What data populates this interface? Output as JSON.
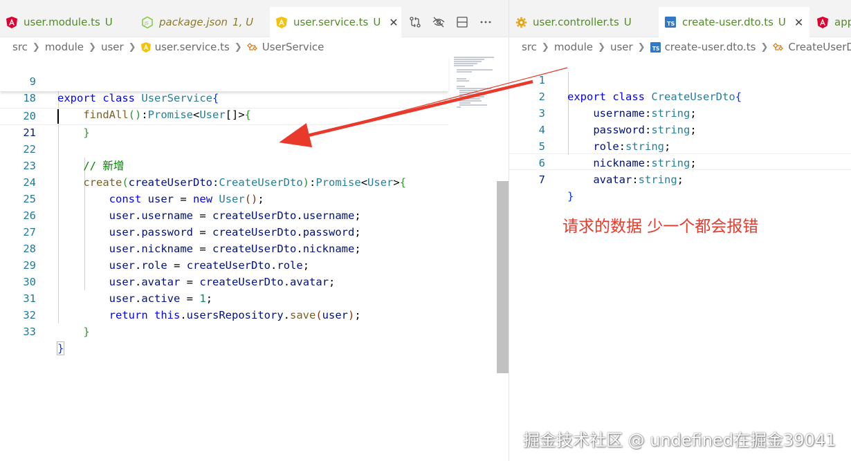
{
  "left_tabs": [
    {
      "label": "user.module.ts",
      "status": "U",
      "icon": "angular-icon",
      "active": false,
      "italic": false
    },
    {
      "label": "package.json",
      "status": "1, U",
      "icon": "nodejs-icon",
      "active": false,
      "italic": true
    },
    {
      "label": "user.service.ts",
      "status": "U",
      "icon": "nestjs-service-icon",
      "active": true,
      "italic": false,
      "close": "✕"
    }
  ],
  "right_tabs": [
    {
      "label": "user.controller.ts",
      "status": "U",
      "icon": "gear-icon",
      "active": false
    },
    {
      "label": "create-user.dto.ts",
      "status": "U",
      "icon": "typescript-icon",
      "active": true,
      "close": "✕"
    },
    {
      "label": "app",
      "status": "",
      "icon": "angular-icon",
      "active": false
    }
  ],
  "editor_actions": [
    "compare-changes-icon",
    "hide-icon",
    "split-editor-icon",
    "more-actions-icon"
  ],
  "left_breadcrumb": [
    "src",
    "module",
    "user",
    "user.service.ts",
    "UserService"
  ],
  "right_breadcrumb": [
    "src",
    "module",
    "user",
    "create-user.dto.ts",
    "CreateUserDto"
  ],
  "left_sticky": [
    {
      "n": "9",
      "t": "export class UserService{"
    },
    {
      "n": "18",
      "t": "    findAll():Promise<User[]>{"
    }
  ],
  "left_lines": [
    {
      "n": "20",
      "t": "    }"
    },
    {
      "n": "21",
      "t": ""
    },
    {
      "n": "22",
      "t": "    // 新增"
    },
    {
      "n": "23",
      "t": "    create(createUserDto:CreateUserDto):Promise<User>{"
    },
    {
      "n": "24",
      "t": "        const user = new User();"
    },
    {
      "n": "25",
      "t": "        user.username = createUserDto.username;"
    },
    {
      "n": "26",
      "t": "        user.password = createUserDto.password;"
    },
    {
      "n": "27",
      "t": "        user.nickname = createUserDto.nickname;"
    },
    {
      "n": "28",
      "t": "        user.role = createUserDto.role;"
    },
    {
      "n": "29",
      "t": "        user.avatar = createUserDto.avatar;"
    },
    {
      "n": "30",
      "t": "        user.active = 1;"
    },
    {
      "n": "31",
      "t": "        return this.usersRepository.save(user);"
    },
    {
      "n": "32",
      "t": "    }"
    },
    {
      "n": "33",
      "t": "}"
    }
  ],
  "right_lines": [
    {
      "n": "1",
      "t": "export class CreateUserDto{"
    },
    {
      "n": "2",
      "t": "    username:string;"
    },
    {
      "n": "3",
      "t": "    password:string;"
    },
    {
      "n": "4",
      "t": "    role:string;"
    },
    {
      "n": "5",
      "t": "    nickname:string;"
    },
    {
      "n": "6",
      "t": "    avatar:string;"
    },
    {
      "n": "7",
      "t": "}"
    }
  ],
  "annotation_text": "请求的数据 少一个都会报错",
  "watermark_text": "掘金技术社区 @ undefined在掘金39041",
  "colors": {
    "accent_arrow": "#e8392a",
    "line_number": "#237893",
    "keyword": "#0000ff",
    "type": "#267f99",
    "function": "#795e26",
    "variable": "#001080",
    "comment": "#008000"
  }
}
